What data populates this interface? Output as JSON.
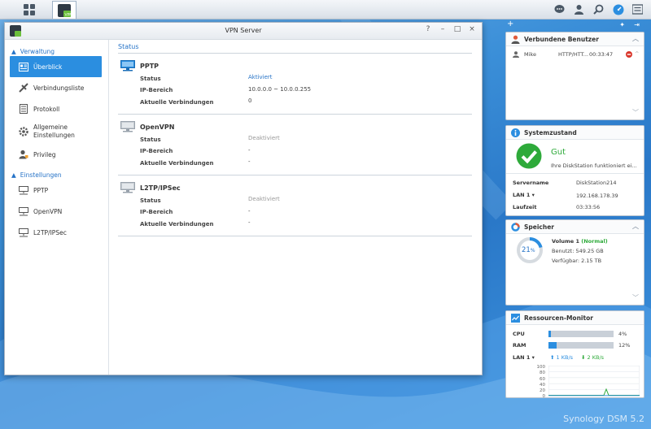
{
  "window": {
    "title": "VPN Server",
    "controls": [
      "?",
      "–",
      "□",
      "×"
    ]
  },
  "sidebar": {
    "sections": [
      {
        "label": "Verwaltung",
        "items": [
          {
            "label": "Überblick",
            "icon": "overview-icon",
            "active": true
          },
          {
            "label": "Verbindungsliste",
            "icon": "connection-list-icon"
          },
          {
            "label": "Protokoll",
            "icon": "log-icon"
          },
          {
            "label_line1": "Allgemeine",
            "label_line2": "Einstellungen",
            "icon": "gear-icon"
          },
          {
            "label": "Privileg",
            "icon": "user-privilege-icon"
          }
        ]
      },
      {
        "label": "Einstellungen",
        "items": [
          {
            "label": "PPTP",
            "icon": "network-icon"
          },
          {
            "label": "OpenVPN",
            "icon": "network-icon"
          },
          {
            "label": "L2TP/IPSec",
            "icon": "network-icon"
          }
        ]
      }
    ]
  },
  "content": {
    "title": "Status",
    "labels": {
      "status": "Status",
      "ip_range": "IP-Bereich",
      "connections": "Aktuelle Verbindungen"
    },
    "vpns": [
      {
        "name": "PPTP",
        "status": "Aktiviert",
        "ip_range": "10.0.0.0 ~ 10.0.0.255",
        "connections": "0",
        "enabled": true
      },
      {
        "name": "OpenVPN",
        "status": "Deaktiviert",
        "ip_range": "-",
        "connections": "-",
        "enabled": false
      },
      {
        "name": "L2TP/IPSec",
        "status": "Deaktiviert",
        "ip_range": "-",
        "connections": "-",
        "enabled": false
      }
    ]
  },
  "widgets": {
    "users": {
      "title": "Verbundene Benutzer",
      "rows": [
        {
          "user": "Mike",
          "protocol": "HTTP/HTT...",
          "time": "00:33:47"
        }
      ]
    },
    "health": {
      "title": "Systemzustand",
      "status": "Gut",
      "message": "Ihre DiskStation funktioniert ei...",
      "server_label": "Servername",
      "server_value": "DiskStation214",
      "lan_label": "LAN 1",
      "lan_value": "192.168.178.39",
      "uptime_label": "Laufzeit",
      "uptime_value": "03:33:56",
      "status_color": "#2eaa3a"
    },
    "storage": {
      "title": "Speicher",
      "percent_text": "21",
      "percent_unit": "%",
      "usage_fraction": 0.21,
      "volume_name": "Volume 1",
      "volume_status": "(Normal)",
      "used": "Benutzt: 549.25 GB",
      "available": "Verfügbar: 2.15 TB"
    },
    "monitor": {
      "title": "Ressourcen-Monitor",
      "cpu_label": "CPU",
      "cpu_value": "4%",
      "cpu_fraction": 0.04,
      "ram_label": "RAM",
      "ram_value": "12%",
      "ram_fraction": 0.12,
      "lan_label": "LAN 1",
      "upload": "1 KB/s",
      "download": "2 KB/s",
      "chart_ticks": [
        "100",
        "80",
        "60",
        "40",
        "20",
        "0"
      ]
    }
  },
  "branding": {
    "logo_text": "Synology DSM 5.2"
  },
  "colors": {
    "accent": "#2b8ee0",
    "link": "#2673c7",
    "ok": "#2eaa3a",
    "danger": "#d9362b"
  }
}
